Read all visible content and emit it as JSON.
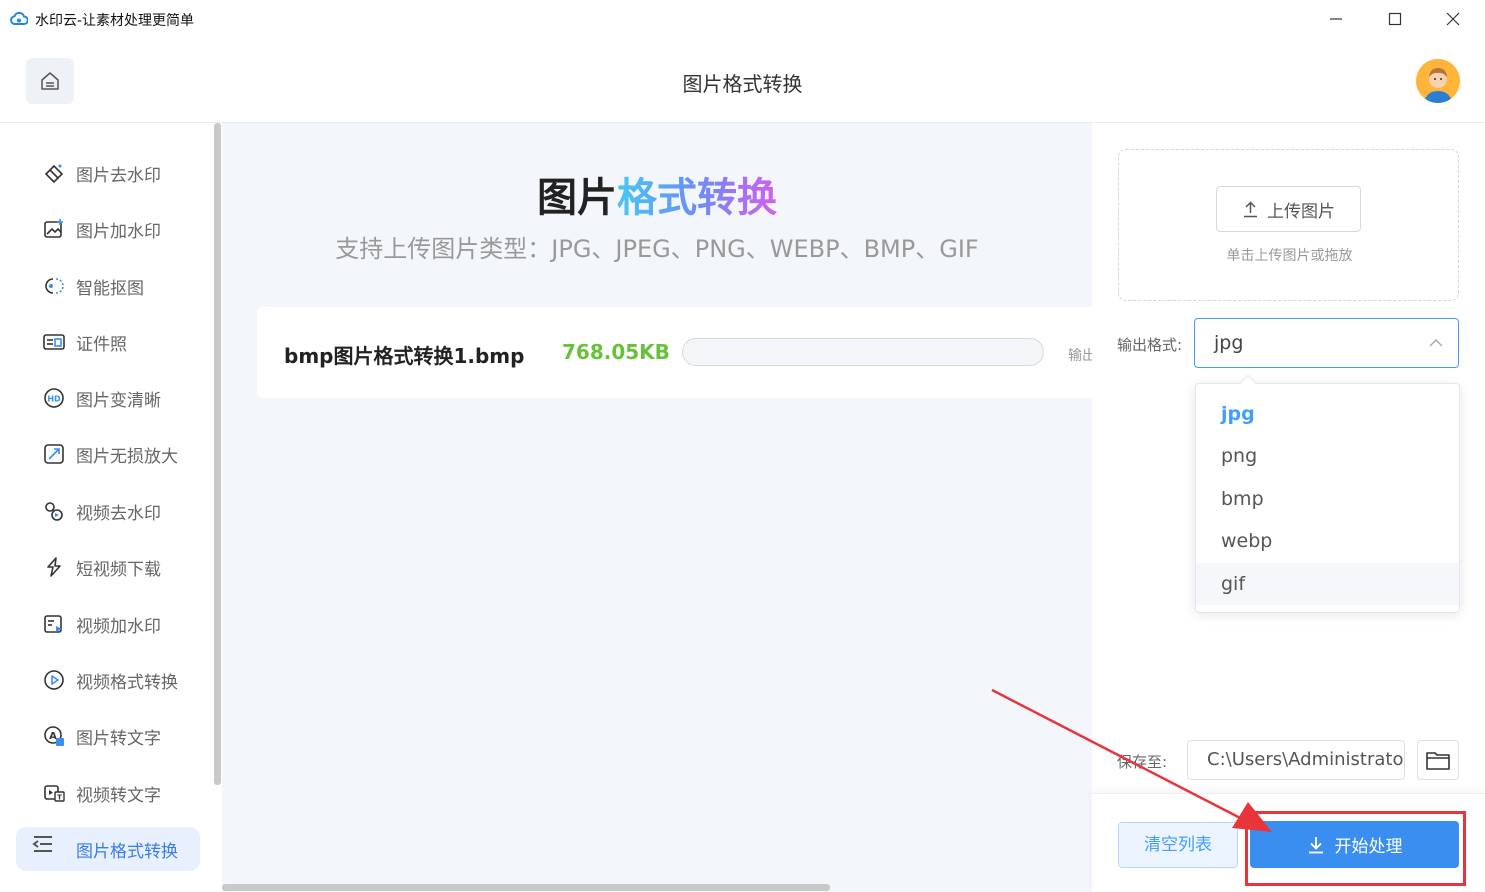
{
  "window": {
    "title": "水印云-让素材处理更简单",
    "controls": [
      "minimize",
      "maximize",
      "close"
    ]
  },
  "header": {
    "title": "图片格式转换"
  },
  "sidebar": {
    "items": [
      {
        "label": "图片去水印",
        "icon": "eraser-icon"
      },
      {
        "label": "图片加水印",
        "icon": "image-add-icon"
      },
      {
        "label": "智能抠图",
        "icon": "cutout-icon"
      },
      {
        "label": "证件照",
        "icon": "id-card-icon"
      },
      {
        "label": "图片变清晰",
        "icon": "hd-icon"
      },
      {
        "label": "图片无损放大",
        "icon": "enlarge-icon"
      },
      {
        "label": "视频去水印",
        "icon": "video-eraser-icon"
      },
      {
        "label": "短视频下载",
        "icon": "short-video-download-icon"
      },
      {
        "label": "视频加水印",
        "icon": "video-add-icon"
      },
      {
        "label": "视频格式转换",
        "icon": "video-convert-icon"
      },
      {
        "label": "图片转文字",
        "icon": "image-text-icon"
      },
      {
        "label": "视频转文字",
        "icon": "video-text-icon"
      },
      {
        "label": "图片格式转换",
        "icon": "image-convert-icon",
        "active": true
      }
    ]
  },
  "main": {
    "hero_title_plain": "图片",
    "hero_title_gradient": "格式转换",
    "hero_subtitle": "支持上传图片类型：JPG、JPEG、PNG、WEBP、BMP、GIF",
    "files": [
      {
        "name": "bmp图片格式转换1.bmp",
        "size": "768.05KB",
        "progress": 0,
        "output_label": "输出"
      }
    ]
  },
  "panel": {
    "upload_button": "上传图片",
    "upload_hint": "单击上传图片或拖放",
    "format_label": "输出格式:",
    "format_value": "jpg",
    "format_options": [
      "jpg",
      "png",
      "bmp",
      "webp",
      "gif"
    ],
    "save_label": "保存至:",
    "save_path": "C:\\Users\\Administrator",
    "clear_button": "清空列表",
    "start_button": "开始处理"
  },
  "colors": {
    "accent": "#3a8ef0",
    "file_size": "#67c23a",
    "annotation": "#e8343a"
  }
}
